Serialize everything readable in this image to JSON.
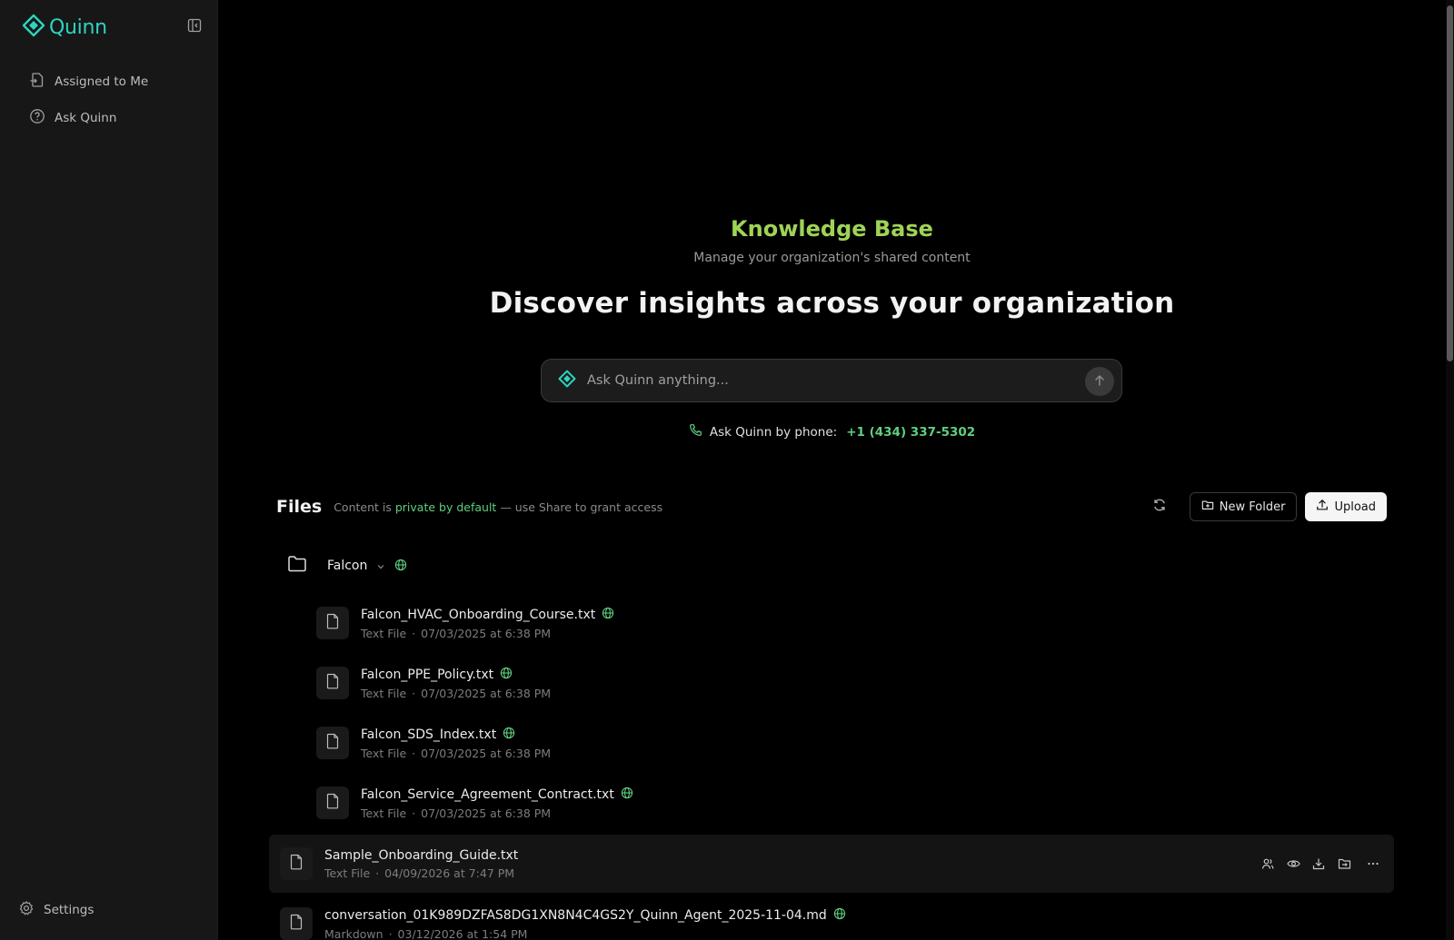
{
  "app": {
    "logo_text": "Quinn",
    "brand_color": "#2dd4bf"
  },
  "sidebar": {
    "items": [
      {
        "label": "Assigned to Me",
        "icon": "file-assign-icon"
      },
      {
        "label": "Ask Quinn",
        "icon": "help-circle-icon"
      }
    ],
    "settings_label": "Settings"
  },
  "hero": {
    "title": "Knowledge Base",
    "subtitle": "Manage your organization's shared content",
    "headline": "Discover insights across your organization",
    "search_placeholder": "Ask Quinn anything...",
    "phone_label": "Ask Quinn by phone:",
    "phone_number": "+1 (434) 337-5302"
  },
  "files": {
    "title": "Files",
    "note_prefix": "Content is",
    "note_accent": "private by default",
    "note_suffix": "— use Share to grant access",
    "new_folder_label": "New Folder",
    "upload_label": "Upload",
    "folder": {
      "name": "Falcon",
      "shared": true
    },
    "nested_files": [
      {
        "name": "Falcon_HVAC_Onboarding_Course.txt",
        "type": "Text File",
        "date": "07/03/2025 at 6:38 PM",
        "shared": true
      },
      {
        "name": "Falcon_PPE_Policy.txt",
        "type": "Text File",
        "date": "07/03/2025 at 6:38 PM",
        "shared": true
      },
      {
        "name": "Falcon_SDS_Index.txt",
        "type": "Text File",
        "date": "07/03/2025 at 6:38 PM",
        "shared": true
      },
      {
        "name": "Falcon_Service_Agreement_Contract.txt",
        "type": "Text File",
        "date": "07/03/2025 at 6:38 PM",
        "shared": true
      }
    ],
    "top_files": [
      {
        "name": "Sample_Onboarding_Guide.txt",
        "type": "Text File",
        "date": "04/09/2026 at 7:47 PM",
        "shared": false
      },
      {
        "name": "conversation_01K989DZFAS8DG1XN8N4C4GS2Y_Quinn_Agent_2025-11-04.md",
        "type": "Markdown",
        "date": "03/12/2026 at 1:54 PM",
        "shared": true
      }
    ],
    "meta_separator": "·"
  }
}
